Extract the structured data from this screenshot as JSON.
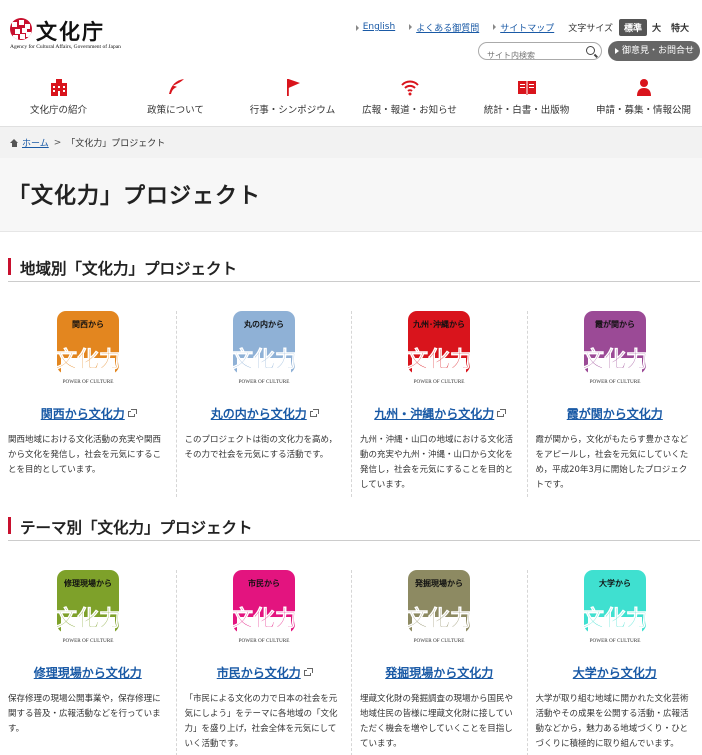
{
  "header": {
    "logo_text": "文化庁",
    "logo_sub": "Agency for Cultural Affairs, Government of Japan",
    "links": [
      "English",
      "よくある御質問",
      "サイトマップ"
    ],
    "font_size_label": "文字サイズ",
    "font_sizes": [
      "標準",
      "大",
      "特大"
    ],
    "search_placeholder": "サイト内検索",
    "inquiry_label": "御意見・お問合せ"
  },
  "gnav": [
    {
      "label": "文化庁の紹介",
      "icon": "building-icon"
    },
    {
      "label": "政策について",
      "icon": "quill-icon"
    },
    {
      "label": "行事・シンポジウム",
      "icon": "flag-icon"
    },
    {
      "label": "広報・報道・お知らせ",
      "icon": "wifi-icon"
    },
    {
      "label": "統計・白書・出版物",
      "icon": "book-icon"
    },
    {
      "label": "申請・募集・情報公開",
      "icon": "person-icon"
    }
  ],
  "breadcrumb": {
    "home": "ホーム",
    "sep": ">",
    "current": "「文化力」プロジェクト"
  },
  "page_title": "「文化力」プロジェクト",
  "sections": [
    {
      "title": "地域別「文化力」プロジェクト",
      "cards": [
        {
          "tile_label": "関西から",
          "color": "#e3861f",
          "title": "関西から文化力",
          "external": true,
          "desc": "関西地域における文化活動の充実や関西から文化を発信し，社会を元気にすることを目的としています。"
        },
        {
          "tile_label": "丸の内から",
          "color": "#8fb1d6",
          "title": "丸の内から文化力",
          "external": true,
          "desc": "このプロジェクトは街の文化力を高め，その力で社会を元気にする活動です。"
        },
        {
          "tile_label": "九州･沖縄から",
          "color": "#d9141c",
          "title": "九州・沖縄から文化力",
          "external": true,
          "desc": "九州・沖縄・山口の地域における文化活動の充実や九州・沖縄・山口から文化を発信し，社会を元気にすることを目的としています。"
        },
        {
          "tile_label": "霞が関から",
          "color": "#9b4a96",
          "title": "霞が関から文化力",
          "external": false,
          "desc": "霞が関から，文化がもたらす豊かさなどをアピールし，社会を元気にしていくため，平成20年3月に開始したプロジェクトです。"
        }
      ]
    },
    {
      "title": "テーマ別「文化力」プロジェクト",
      "cards": [
        {
          "tile_label": "修理現場から",
          "color": "#7ea12a",
          "title": "修理現場から文化力",
          "external": false,
          "desc": "保存修理の現場公開事業や，保存修理に関する普及・広報活動などを行っています。"
        },
        {
          "tile_label": "市民から",
          "color": "#e3147f",
          "title": "市民から文化力",
          "external": true,
          "desc": "「市民による文化の力で日本の社会を元気にしよう」をテーマに各地域の「文化力」を盛り上げ，社会全体を元気にしていく活動です。"
        },
        {
          "tile_label": "発掘現場から",
          "color": "#8d8a62",
          "title": "発掘現場から文化力",
          "external": false,
          "desc": "埋蔵文化財の発掘調査の現場から国民や地域住民の皆様に埋蔵文化財に接していただく機会を増やしていくことを目指しています。"
        },
        {
          "tile_label": "大学から",
          "color": "#3fe0d0",
          "title": "大学から文化力",
          "external": false,
          "desc": "大学が取り組む地域に開かれた文化芸術活動やその成果を公開する活動・広報活動などから，魅力ある地域づくり・ひとづくりに積極的に取り組んでいます。"
        }
      ]
    }
  ],
  "tile_word": "文化力",
  "tile_tagline": "POWER OF CULTURE",
  "accent": "#c8102e",
  "link_color": "#1a5aa6"
}
